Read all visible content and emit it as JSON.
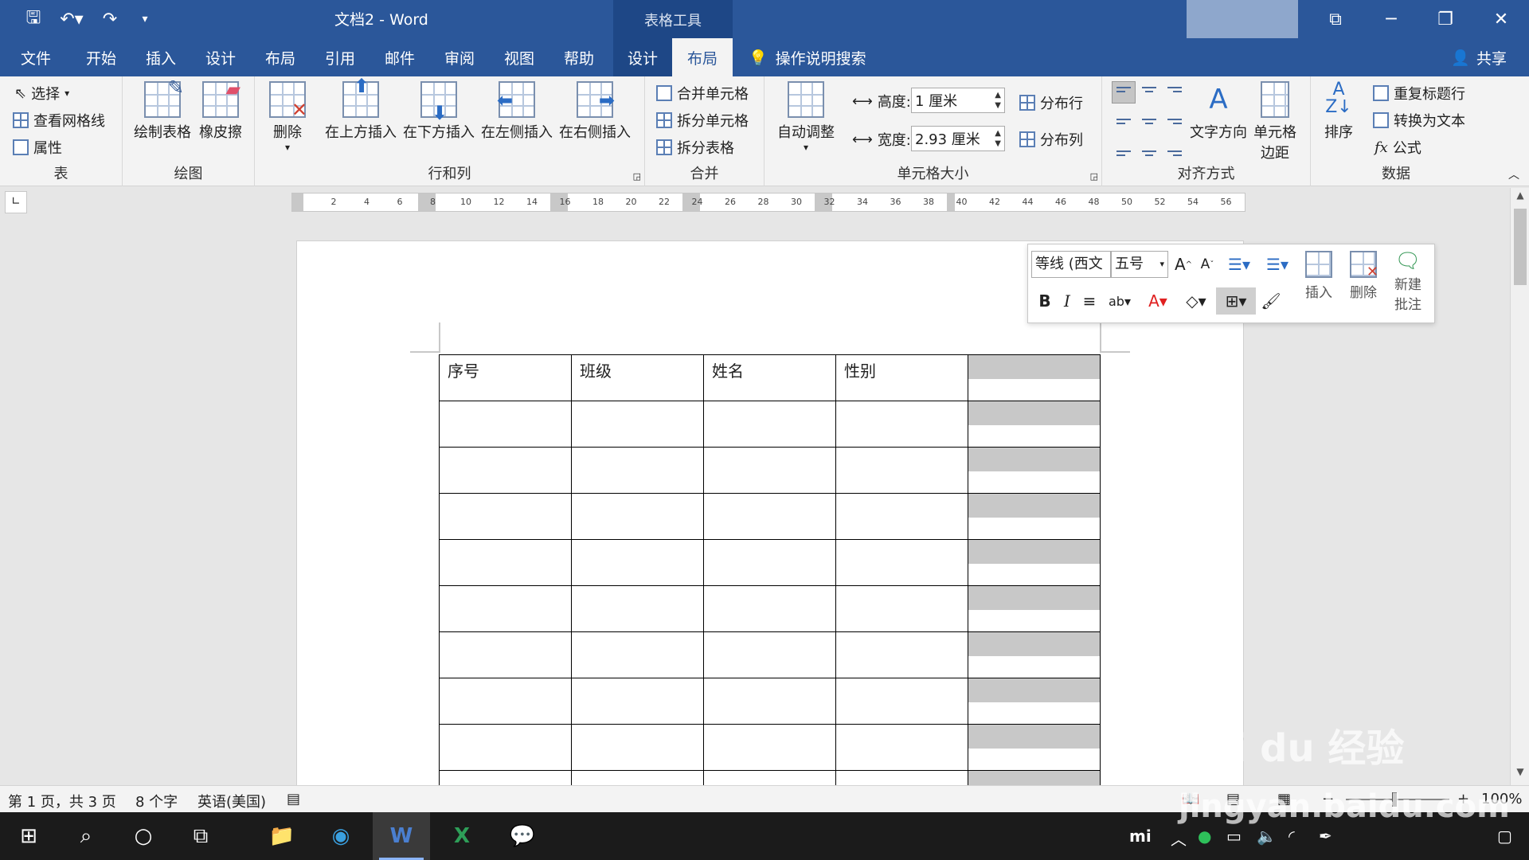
{
  "titlebar": {
    "doc_title": "文档2 - Word",
    "context_group": "表格工具"
  },
  "tabs": [
    "文件",
    "开始",
    "插入",
    "设计",
    "布局",
    "引用",
    "邮件",
    "审阅",
    "视图",
    "帮助",
    "设计",
    "布局"
  ],
  "active_tab_index": 11,
  "search_label": "操作说明搜索",
  "share_label": "共享",
  "ribbon": {
    "table": {
      "label": "表",
      "select": "选择",
      "gridlines": "查看网格线",
      "properties": "属性"
    },
    "draw": {
      "label": "绘图",
      "draw_table": "绘制表格",
      "eraser": "橡皮擦"
    },
    "rows_cols": {
      "label": "行和列",
      "delete": "删除",
      "insert_above": "在上方插入",
      "insert_below": "在下方插入",
      "insert_left": "在左侧插入",
      "insert_right": "在右侧插入"
    },
    "merge": {
      "label": "合并",
      "merge_cells": "合并单元格",
      "split_cells": "拆分单元格",
      "split_table": "拆分表格"
    },
    "cell_size": {
      "label": "单元格大小",
      "autofit": "自动调整",
      "height_label": "高度:",
      "height_value": "1 厘米",
      "width_label": "宽度:",
      "width_value": "2.93 厘米",
      "distribute_rows": "分布行",
      "distribute_cols": "分布列"
    },
    "alignment": {
      "label": "对齐方式",
      "text_direction": "文字方向",
      "cell_margins_1": "单元格",
      "cell_margins_2": "边距"
    },
    "data": {
      "label": "数据",
      "sort": "排序",
      "repeat_header": "重复标题行",
      "convert_to_text": "转换为文本",
      "formula": "公式"
    }
  },
  "ruler_numbers": [
    "2",
    "4",
    "6",
    "8",
    "10",
    "12",
    "14",
    "16",
    "18",
    "20",
    "22",
    "24",
    "26",
    "28",
    "30",
    "32",
    "34",
    "36",
    "38",
    "40",
    "42",
    "44",
    "46",
    "48",
    "50",
    "52",
    "54",
    "56"
  ],
  "table": {
    "headers": [
      "序号",
      "班级",
      "姓名",
      "性别",
      ""
    ],
    "row_count": 10
  },
  "mini_toolbar": {
    "font": "等线 (西文",
    "size": "五号",
    "insert": "插入",
    "delete": "删除",
    "new_comment_1": "新建",
    "new_comment_2": "批注"
  },
  "statusbar": {
    "page": "第 1 页，共 3 页",
    "words": "8 个字",
    "language": "英语(美国)",
    "zoom": "100%"
  },
  "watermark": {
    "logo": "Bai du 经验",
    "url": "jingyan.baidu.com"
  },
  "colors": {
    "word_blue": "#2b579a",
    "context_blue": "#1e4786",
    "ribbon_bg": "#f3f3f3",
    "taskbar": "#1b1b1b"
  }
}
